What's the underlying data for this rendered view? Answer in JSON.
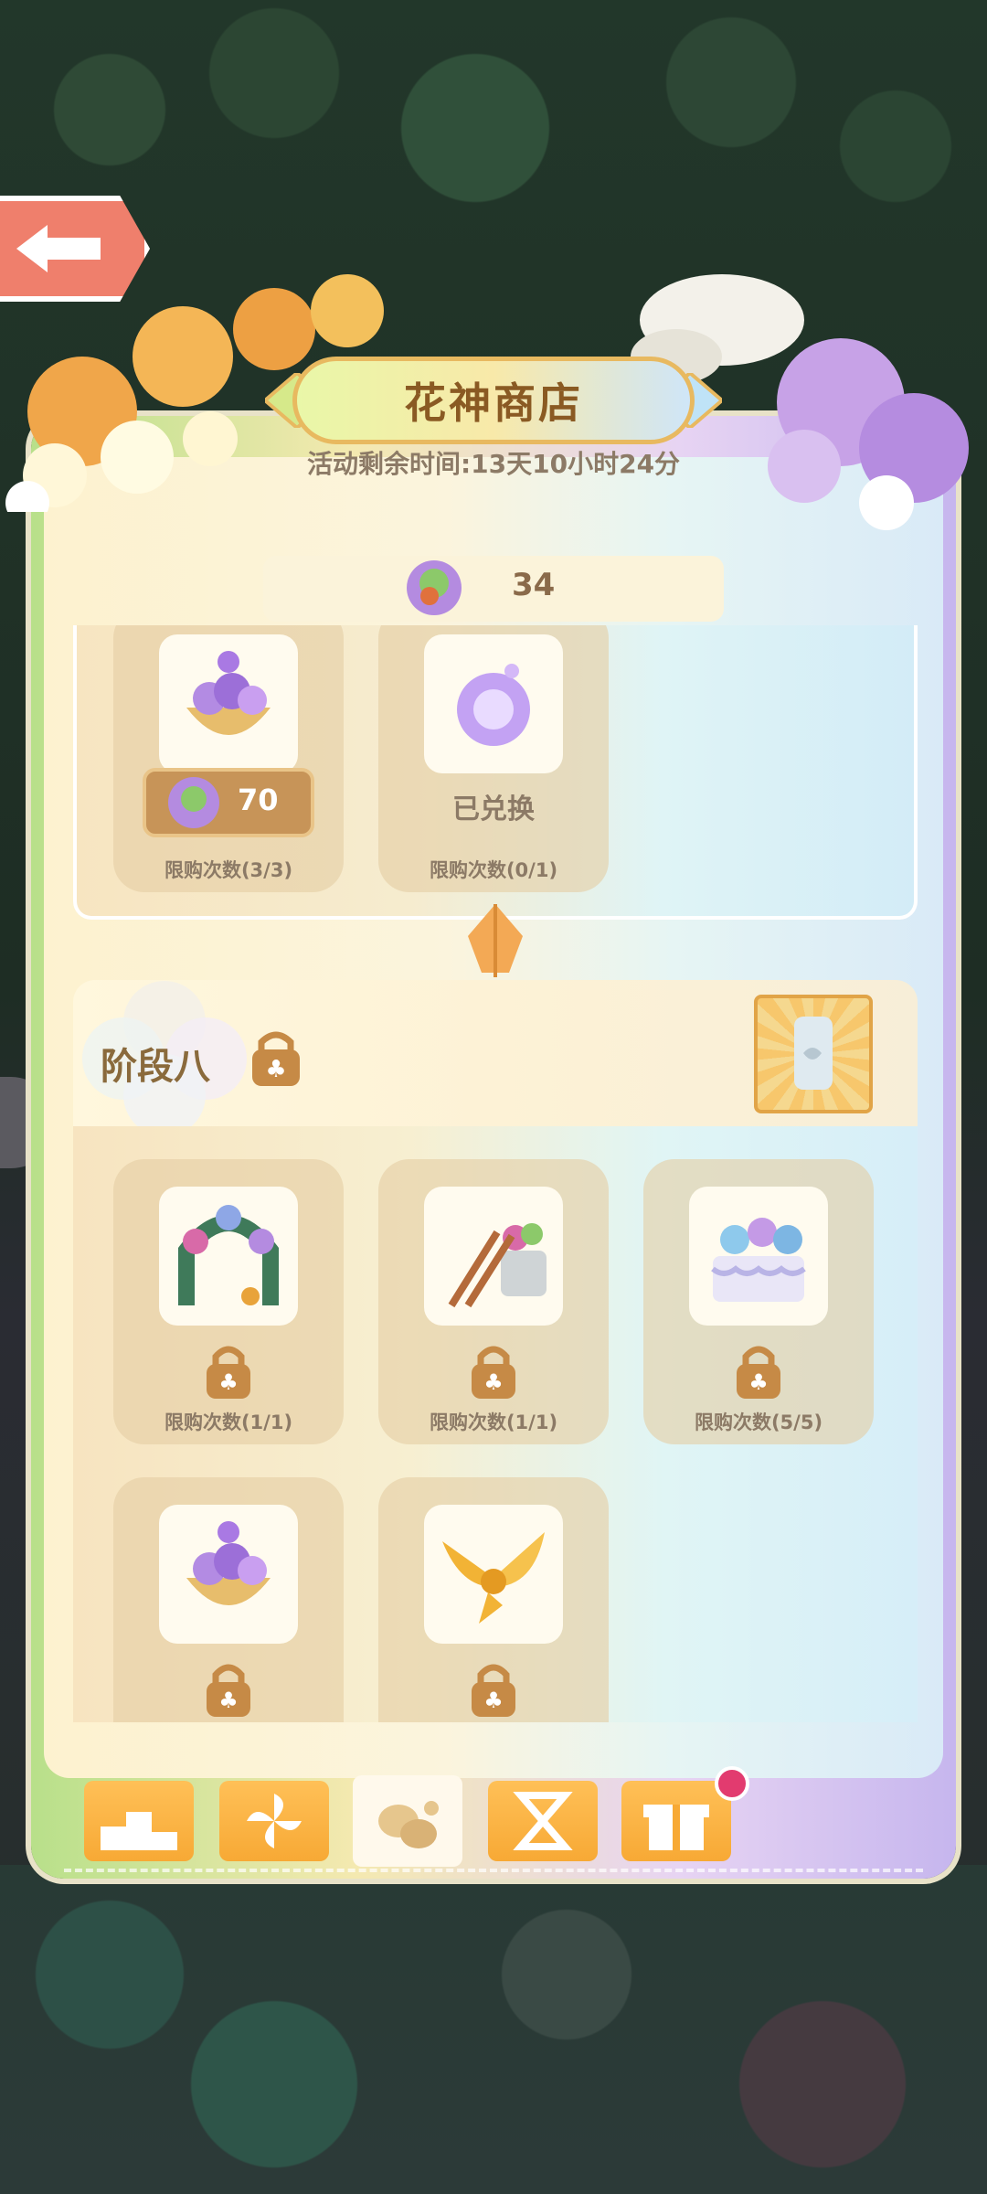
{
  "header": {
    "title": "花神商店",
    "countdown": "活动剩余时间:13天10小时24分"
  },
  "currency": {
    "icon": "flower-token-icon",
    "value": "34"
  },
  "previous_stage": {
    "items": [
      {
        "icon": "flower-basket-icon",
        "price": "70",
        "limit": "限购次数(3/3)"
      },
      {
        "icon": "purple-orb-icon",
        "status": "已兑换",
        "limit": "限购次数(0/1)"
      }
    ]
  },
  "stage": {
    "title": "阶段八",
    "items": [
      {
        "icon": "flower-arch-icon",
        "limit": "限购次数(1/1)"
      },
      {
        "icon": "garden-ladder-icon",
        "limit": "限购次数(1/1)"
      },
      {
        "icon": "flower-cake-icon",
        "limit": "限购次数(5/5)"
      },
      {
        "icon": "flower-basket-icon",
        "limit": ""
      },
      {
        "icon": "golden-wings-icon",
        "limit": ""
      }
    ]
  },
  "tabs": [
    {
      "icon": "podium-icon"
    },
    {
      "icon": "pinwheel-icon"
    },
    {
      "icon": "coins-icon",
      "active": true
    },
    {
      "icon": "hourglass-icon"
    },
    {
      "icon": "gift-icon"
    }
  ],
  "colors": {
    "accent": "#f7a935",
    "title_text": "#8a5a23",
    "price_button": "#c79458",
    "notify": "#e23b6f"
  }
}
